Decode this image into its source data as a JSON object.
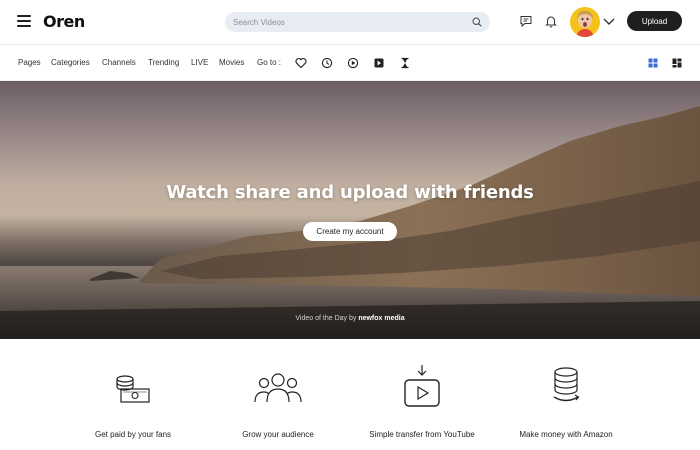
{
  "header": {
    "logo": "Oren",
    "search_placeholder": "Search Videos",
    "upload_label": "Upload",
    "icons": [
      "menu-icon",
      "search-icon",
      "chat-icon",
      "bell-icon",
      "avatar",
      "chevron-down-icon"
    ]
  },
  "nav": {
    "items": [
      "Pages",
      "Categories",
      "Channels",
      "Trending",
      "LIVE",
      "Movies"
    ],
    "goto_label": "Go to :",
    "goto_icons": [
      "heart-icon",
      "clock-icon",
      "play-circle-icon",
      "playlist-icon",
      "hourglass-icon"
    ],
    "view_icons": [
      "grid-view-icon",
      "masonry-view-icon"
    ]
  },
  "hero": {
    "title": "Watch share and upload with friends",
    "cta_label": "Create my account",
    "caption_prefix": "Video of the Day by ",
    "caption_author": "newfox media"
  },
  "features": [
    {
      "label": "Get paid by your fans",
      "icon": "money-stack-icon"
    },
    {
      "label": "Grow your audience",
      "icon": "audience-icon"
    },
    {
      "label": "Simple transfer from YouTube",
      "icon": "youtube-transfer-icon"
    },
    {
      "label": "Make money with Amazon",
      "icon": "amazon-coins-icon"
    }
  ],
  "colors": {
    "accent": "#3b6fd8",
    "button_dark": "#1f1f1f",
    "search_bg": "#e8edf4",
    "avatar_bg": "#f4c21b"
  }
}
